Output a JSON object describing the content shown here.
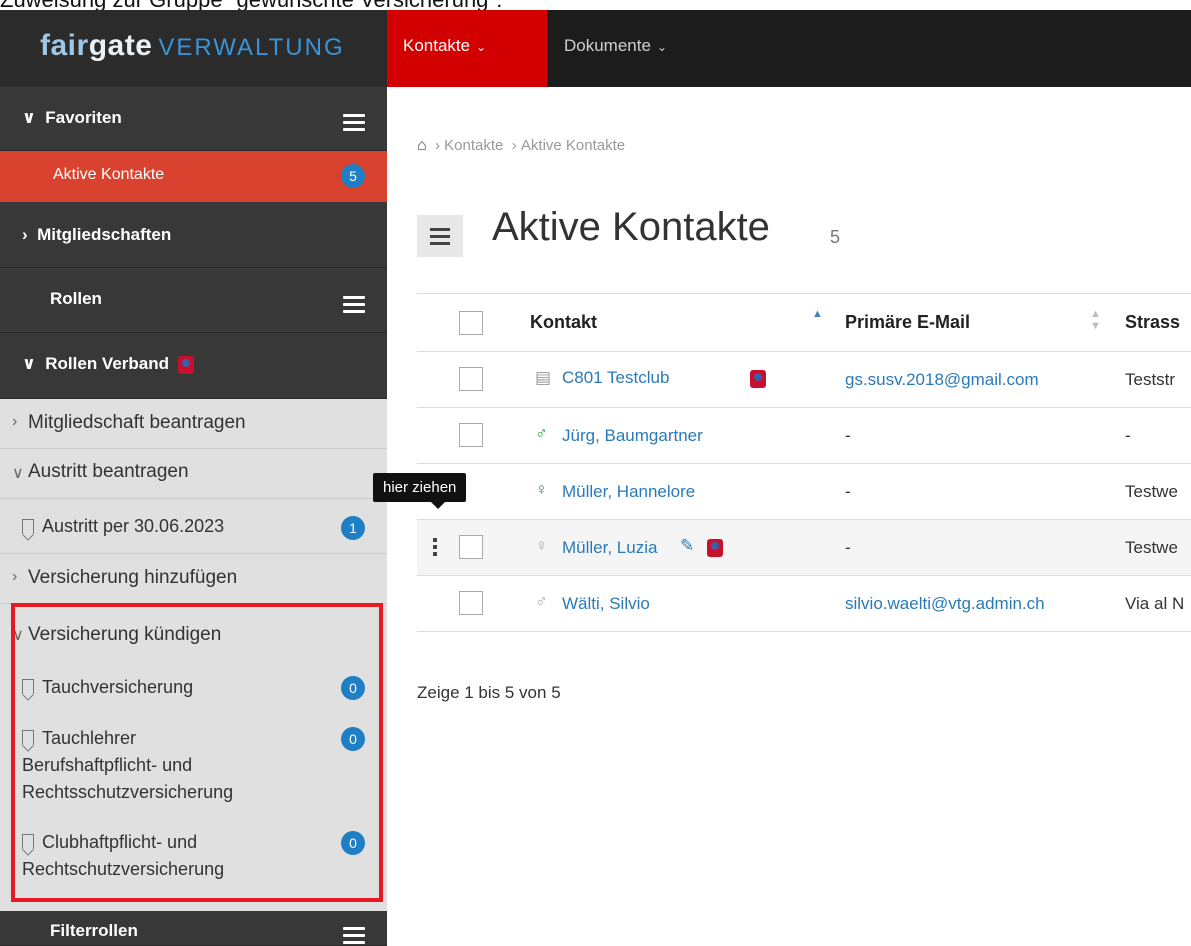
{
  "caption": "Zuweisung zur Gruppe \"gewünschte Versicherung\":",
  "brand": {
    "name_a": "fair",
    "name_b": "gate",
    "suffix": "VERWALTUNG"
  },
  "topnav": [
    {
      "label": "Kontakte",
      "active": true
    },
    {
      "label": "Dokumente",
      "active": false
    }
  ],
  "sidebar": {
    "favoriten": "Favoriten",
    "aktive_kontakte": {
      "label": "Aktive Kontakte",
      "count": "5"
    },
    "mitgliedschaften": "Mitgliedschaften",
    "rollen": "Rollen",
    "rollen_verband": "Rollen Verband",
    "mitgliedschaft_beantragen": "Mitgliedschaft beantragen",
    "austritt_beantragen": "Austritt beantragen",
    "austritt_per": {
      "label": "Austritt per 30.06.2023",
      "count": "1"
    },
    "versicherung_hinzufuegen": "Versicherung hinzufügen",
    "versicherung_kuendigen": "Versicherung kündigen",
    "tauchversicherung": {
      "label": "Tauchversicherung",
      "count": "0"
    },
    "tauchlehrer": {
      "line1": "Tauchlehrer",
      "line2": "Berufshaftpflicht- und",
      "line3": "Rechtsschutzversicherung",
      "count": "0"
    },
    "clubhaftpflicht": {
      "line1": "Clubhaftpflicht- und",
      "line2": "Rechtschutzversicherung",
      "count": "0"
    },
    "filterrollen": "Filterrollen"
  },
  "breadcrumb": {
    "level1": "Kontakte",
    "level2": "Aktive Kontakte"
  },
  "page": {
    "title": "Aktive Kontakte",
    "count": "5"
  },
  "table": {
    "headers": {
      "kontakt": "Kontakt",
      "email": "Primäre E-Mail",
      "strasse": "Strass"
    },
    "rows": [
      {
        "name": "C801 Testclub",
        "email": "gs.susv.2018@gmail.com",
        "street": "Teststr"
      },
      {
        "name": "Jürg, Baumgartner",
        "email": "-",
        "street": "-"
      },
      {
        "name": "Müller, Hannelore",
        "email": "-",
        "street": "Testwe"
      },
      {
        "name": "Müller, Luzia",
        "email": "-",
        "street": "Testwe"
      },
      {
        "name": "Wälti, Silvio",
        "email": "silvio.waelti@vtg.admin.ch",
        "street": "Via al N"
      }
    ]
  },
  "tooltip": "hier ziehen",
  "footer": "Zeige 1 bis 5 von 5",
  "colors": {
    "accent_red": "#d20000",
    "active_item": "#da4230",
    "badge_blue": "#1f7fc4",
    "link_blue": "#2a7ab8",
    "highlight_frame": "#e41b23"
  }
}
